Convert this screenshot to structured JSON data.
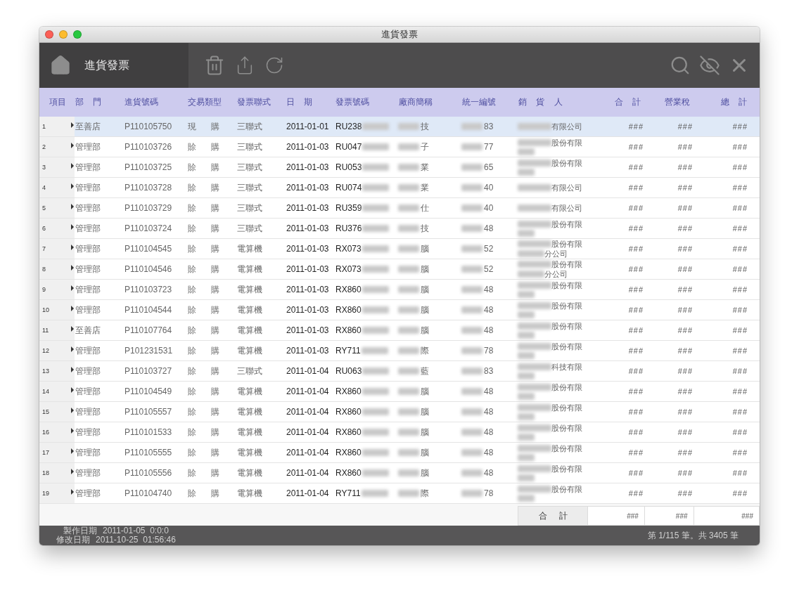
{
  "window": {
    "title": "進貨發票"
  },
  "toolbar": {
    "title": "進貨發票"
  },
  "columns": [
    "項目",
    "部 門",
    "進貨號碼",
    "交易類型",
    "發票聯式",
    "日 期",
    "發票號碼",
    "廠商簡稱",
    "統一編號",
    "銷 貨 人",
    "合 計",
    "營業稅",
    "總 計"
  ],
  "rows": [
    {
      "number": "1",
      "selected": true,
      "department": "至善店",
      "order_no": "P110105750",
      "trade_type": "現 購",
      "invoice_type": "三聯式",
      "date": "2011-01-01",
      "invoice_no": "RU238",
      "vendor": "技",
      "tax_id": "83",
      "seller": "有限公司",
      "seller_two_lines": false,
      "total": "###",
      "tax": "###",
      "grand_total": "###"
    },
    {
      "number": "2",
      "selected": false,
      "department": "管理部",
      "order_no": "P110103726",
      "trade_type": "賒 購",
      "invoice_type": "三聯式",
      "date": "2011-01-03",
      "invoice_no": "RU047",
      "vendor": "子",
      "tax_id": "77",
      "seller": "股份有限",
      "seller_two_lines": true,
      "total": "###",
      "tax": "###",
      "grand_total": "###"
    },
    {
      "number": "3",
      "selected": false,
      "department": "管理部",
      "order_no": "P110103725",
      "trade_type": "賒 購",
      "invoice_type": "三聯式",
      "date": "2011-01-03",
      "invoice_no": "RU053",
      "vendor": "業",
      "tax_id": "65",
      "seller": "股份有限",
      "seller_two_lines": true,
      "total": "###",
      "tax": "###",
      "grand_total": "###"
    },
    {
      "number": "4",
      "selected": false,
      "department": "管理部",
      "order_no": "P110103728",
      "trade_type": "賒 購",
      "invoice_type": "三聯式",
      "date": "2011-01-03",
      "invoice_no": "RU074",
      "vendor": "業",
      "tax_id": "40",
      "seller": "有限公司",
      "seller_two_lines": false,
      "total": "###",
      "tax": "###",
      "grand_total": "###"
    },
    {
      "number": "5",
      "selected": false,
      "department": "管理部",
      "order_no": "P110103729",
      "trade_type": "賒 購",
      "invoice_type": "三聯式",
      "date": "2011-01-03",
      "invoice_no": "RU359",
      "vendor": "仕",
      "tax_id": "40",
      "seller": "有限公司",
      "seller_two_lines": false,
      "total": "###",
      "tax": "###",
      "grand_total": "###"
    },
    {
      "number": "6",
      "selected": false,
      "department": "管理部",
      "order_no": "P110103724",
      "trade_type": "賒 購",
      "invoice_type": "三聯式",
      "date": "2011-01-03",
      "invoice_no": "RU376",
      "vendor": "技",
      "tax_id": "48",
      "seller": "股份有限",
      "seller_two_lines": true,
      "total": "###",
      "tax": "###",
      "grand_total": "###"
    },
    {
      "number": "7",
      "selected": false,
      "department": "管理部",
      "order_no": "P110104545",
      "trade_type": "賒 購",
      "invoice_type": "電算機",
      "date": "2011-01-03",
      "invoice_no": "RX073",
      "vendor": "腦",
      "tax_id": "52",
      "seller": "股份有限",
      "seller_line_2": "分公司",
      "seller_two_lines": true,
      "total": "###",
      "tax": "###",
      "grand_total": "###"
    },
    {
      "number": "8",
      "selected": false,
      "department": "管理部",
      "order_no": "P110104546",
      "trade_type": "賒 購",
      "invoice_type": "電算機",
      "date": "2011-01-03",
      "invoice_no": "RX073",
      "vendor": "腦",
      "tax_id": "52",
      "seller": "股份有限",
      "seller_line_2": "分公司",
      "seller_two_lines": true,
      "total": "###",
      "tax": "###",
      "grand_total": "###"
    },
    {
      "number": "9",
      "selected": false,
      "department": "管理部",
      "order_no": "P110103723",
      "trade_type": "賒 購",
      "invoice_type": "電算機",
      "date": "2011-01-03",
      "invoice_no": "RX860",
      "vendor": "腦",
      "tax_id": "48",
      "seller": "股份有限",
      "seller_two_lines": true,
      "total": "###",
      "tax": "###",
      "grand_total": "###"
    },
    {
      "number": "10",
      "selected": false,
      "department": "管理部",
      "order_no": "P110104544",
      "trade_type": "賒 購",
      "invoice_type": "電算機",
      "date": "2011-01-03",
      "invoice_no": "RX860",
      "vendor": "腦",
      "tax_id": "48",
      "seller": "股份有限",
      "seller_two_lines": true,
      "total": "###",
      "tax": "###",
      "grand_total": "###"
    },
    {
      "number": "11",
      "selected": false,
      "department": "至善店",
      "order_no": "P110107764",
      "trade_type": "賒 購",
      "invoice_type": "電算機",
      "date": "2011-01-03",
      "invoice_no": "RX860",
      "vendor": "腦",
      "tax_id": "48",
      "seller": "股份有限",
      "seller_two_lines": true,
      "total": "###",
      "tax": "###",
      "grand_total": "###"
    },
    {
      "number": "12",
      "selected": false,
      "department": "管理部",
      "order_no": "P101231531",
      "trade_type": "賒 購",
      "invoice_type": "電算機",
      "date": "2011-01-03",
      "invoice_no": "RY711",
      "vendor": "際",
      "tax_id": "78",
      "seller": "股份有限",
      "seller_two_lines": true,
      "total": "###",
      "tax": "###",
      "grand_total": "###"
    },
    {
      "number": "13",
      "selected": false,
      "department": "管理部",
      "order_no": "P110103727",
      "trade_type": "賒 購",
      "invoice_type": "三聯式",
      "date": "2011-01-04",
      "invoice_no": "RU063",
      "vendor": "藍",
      "tax_id": "83",
      "seller": "科技有限",
      "seller_two_lines": true,
      "total": "###",
      "tax": "###",
      "grand_total": "###"
    },
    {
      "number": "14",
      "selected": false,
      "department": "管理部",
      "order_no": "P110104549",
      "trade_type": "賒 購",
      "invoice_type": "電算機",
      "date": "2011-01-04",
      "invoice_no": "RX860",
      "vendor": "腦",
      "tax_id": "48",
      "seller": "股份有限",
      "seller_two_lines": true,
      "total": "###",
      "tax": "###",
      "grand_total": "###"
    },
    {
      "number": "15",
      "selected": false,
      "department": "管理部",
      "order_no": "P110105557",
      "trade_type": "賒 購",
      "invoice_type": "電算機",
      "date": "2011-01-04",
      "invoice_no": "RX860",
      "vendor": "腦",
      "tax_id": "48",
      "seller": "股份有限",
      "seller_two_lines": true,
      "total": "###",
      "tax": "###",
      "grand_total": "###"
    },
    {
      "number": "16",
      "selected": false,
      "department": "管理部",
      "order_no": "P110101533",
      "trade_type": "賒 購",
      "invoice_type": "電算機",
      "date": "2011-01-04",
      "invoice_no": "RX860",
      "vendor": "腦",
      "tax_id": "48",
      "seller": "股份有限",
      "seller_two_lines": true,
      "total": "###",
      "tax": "###",
      "grand_total": "###"
    },
    {
      "number": "17",
      "selected": false,
      "department": "管理部",
      "order_no": "P110105555",
      "trade_type": "賒 購",
      "invoice_type": "電算機",
      "date": "2011-01-04",
      "invoice_no": "RX860",
      "vendor": "腦",
      "tax_id": "48",
      "seller": "股份有限",
      "seller_two_lines": true,
      "total": "###",
      "tax": "###",
      "grand_total": "###"
    },
    {
      "number": "18",
      "selected": false,
      "department": "管理部",
      "order_no": "P110105556",
      "trade_type": "賒 購",
      "invoice_type": "電算機",
      "date": "2011-01-04",
      "invoice_no": "RX860",
      "vendor": "腦",
      "tax_id": "48",
      "seller": "股份有限",
      "seller_two_lines": true,
      "total": "###",
      "tax": "###",
      "grand_total": "###"
    },
    {
      "number": "19",
      "selected": false,
      "department": "管理部",
      "order_no": "P110104740",
      "trade_type": "賒 購",
      "invoice_type": "電算機",
      "date": "2011-01-04",
      "invoice_no": "RY711",
      "vendor": "際",
      "tax_id": "78",
      "seller": "股份有限",
      "seller_two_lines": true,
      "total": "###",
      "tax": "###",
      "grand_total": "###"
    }
  ],
  "totals": {
    "label": "合 計",
    "total": "###",
    "tax": "###",
    "grand_total": "###"
  },
  "footer": {
    "created_label": "製作日期",
    "created_value": "2011-01-05  0:0:0",
    "modified_label": "修改日期",
    "modified_value": "2011-10-25  01:56:46",
    "pagination": "第 1/115 筆。共 3405 筆"
  }
}
